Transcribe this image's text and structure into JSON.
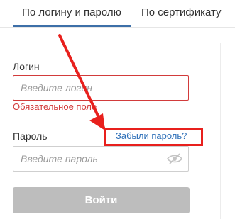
{
  "tabs": [
    {
      "label": "По логину и паролю",
      "active": true
    },
    {
      "label": "По сертификату",
      "active": false
    }
  ],
  "form": {
    "login_label": "Логин",
    "login_placeholder": "Введите логин",
    "login_error": "Обязательное поле",
    "password_label": "Пароль",
    "password_placeholder": "Введите пароль",
    "forgot_link": "Забыли пароль?",
    "submit_label": "Войти"
  },
  "colors": {
    "accent": "#3d6fa8",
    "error": "#d23b3b",
    "link": "#2d6fb8",
    "annotation": "#e8201d",
    "button_disabled": "#bdbdbd"
  },
  "icons": {
    "password_toggle": "eye-slash-icon"
  }
}
